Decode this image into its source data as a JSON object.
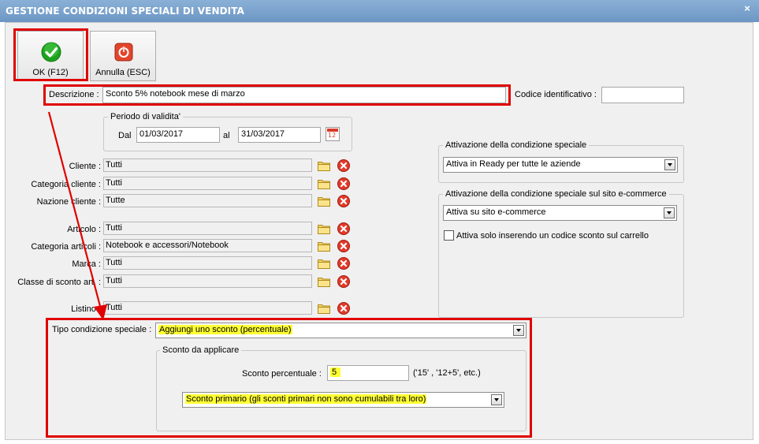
{
  "window": {
    "title": "GESTIONE CONDIZIONI SPECIALI DI VENDITA",
    "close_glyph": "×"
  },
  "toolbar": {
    "ok_label": "OK (F12)",
    "cancel_label": "Annulla (ESC)"
  },
  "descrizione": {
    "label": "Descrizione :",
    "value": "Sconto 5% notebook mese di marzo"
  },
  "codice": {
    "label": "Codice identificativo :",
    "value": ""
  },
  "periodo": {
    "legend": "Periodo di validita'",
    "dal_label": "Dal",
    "dal_value": "01/03/2017",
    "al_label": "al",
    "al_value": "31/03/2017",
    "calendar_number": "12"
  },
  "filters": [
    {
      "label": "Cliente :",
      "value": "Tutti"
    },
    {
      "label": "Categoria cliente :",
      "value": "Tutti"
    },
    {
      "label": "Nazione cliente :",
      "value": "Tutte"
    },
    {
      "label": "Articolo :",
      "value": "Tutti"
    },
    {
      "label": "Categoria articoli :",
      "value": "Notebook e accessori/Notebook"
    },
    {
      "label": "Marca :",
      "value": "Tutti"
    },
    {
      "label": "Classe di sconto art. :",
      "value": "Tutti"
    },
    {
      "label": "Listino :",
      "value": "Tutti"
    }
  ],
  "attivazione": {
    "legend": "Attivazione della condizione speciale",
    "value": "Attiva in Ready per tutte le aziende"
  },
  "ecommerce": {
    "legend": "Attivazione della condizione speciale sul sito e-commerce",
    "value": "Attiva su sito e-commerce",
    "checkbox_label": "Attiva solo inserendo un codice sconto sul carrello",
    "checkbox_checked": false
  },
  "tipo": {
    "label": "Tipo condizione speciale :",
    "value": "Aggiungi uno sconto (percentuale)"
  },
  "sconto": {
    "legend": "Sconto da applicare",
    "perc_label": "Sconto percentuale :",
    "perc_value": "5",
    "hint": "('15' ,  '12+5', etc.)",
    "tipo_value": "Sconto primario (gli sconti primari non sono cumulabili tra loro)"
  },
  "colors": {
    "accent_red": "#e00000",
    "highlight": "#ffff33",
    "titlebar": "#7aa3cf"
  }
}
